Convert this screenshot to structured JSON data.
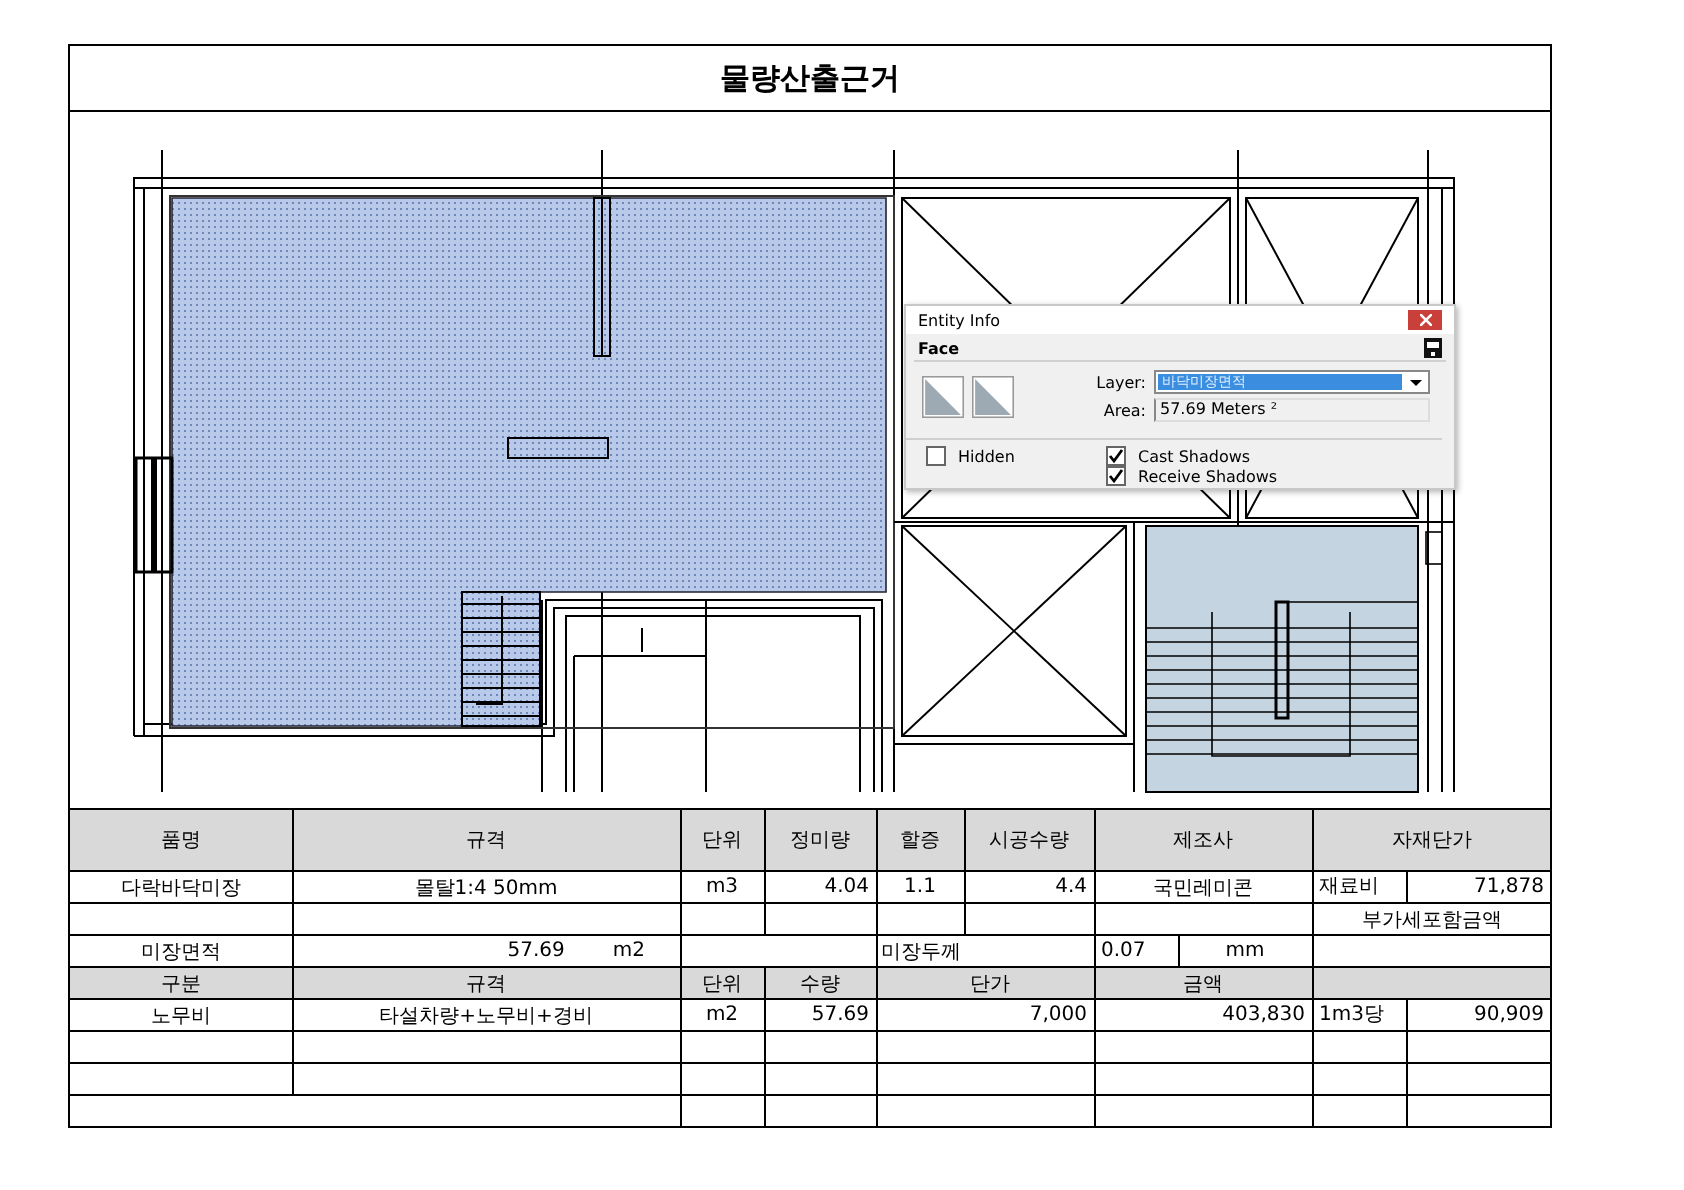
{
  "title": "물량산출근거",
  "entity_info": {
    "title": "Entity Info",
    "section": "Face",
    "layer_label": "Layer:",
    "layer_value": "바닥미장면적",
    "area_label": "Area:",
    "area_value": "57.69 Meters ²",
    "checkboxes": [
      {
        "label": "Hidden",
        "checked": false
      },
      {
        "label": "Cast Shadows",
        "checked": true
      },
      {
        "label": "Receive Shadows",
        "checked": true
      }
    ]
  },
  "table": {
    "rows": [
      {
        "kind": "header",
        "cells": [
          {
            "kind": "header",
            "text": "품명"
          },
          {
            "kind": "header",
            "text": "규격"
          },
          {
            "kind": "header",
            "text": "단위"
          },
          {
            "kind": "header",
            "text": "정미량"
          },
          {
            "kind": "header",
            "text": "할증"
          },
          {
            "kind": "header",
            "text": "시공수량"
          },
          {
            "kind": "header",
            "text": "제조사"
          },
          {
            "kind": "header",
            "text": "자재단가"
          }
        ]
      },
      {
        "kind": "data",
        "cells": [
          {
            "kind": "text",
            "text": "다락바닥미장"
          },
          {
            "kind": "text",
            "text": "몰탈1:4 50mm"
          },
          {
            "kind": "text",
            "text": "m3"
          },
          {
            "kind": "number",
            "text": "4.04"
          },
          {
            "kind": "text",
            "text": "1.1"
          },
          {
            "kind": "number",
            "text": "4.4"
          },
          {
            "kind": "text",
            "text": "국민레미콘"
          },
          {
            "kind": "split",
            "label": "재료비",
            "text": "71,878"
          }
        ]
      },
      {
        "kind": "data",
        "cells": [
          {
            "kind": "empty"
          },
          {
            "kind": "empty"
          },
          {
            "kind": "empty"
          },
          {
            "kind": "empty"
          },
          {
            "kind": "empty"
          },
          {
            "kind": "empty"
          },
          {
            "kind": "empty"
          },
          {
            "kind": "text",
            "text": "부가세포함금액"
          }
        ]
      },
      {
        "kind": "data",
        "cells": [
          {
            "kind": "text",
            "text": "미장면적"
          },
          {
            "kind": "measure",
            "text": "57.69",
            "unit": "m2"
          },
          {
            "kind": "empty"
          },
          {
            "kind": "open_left"
          },
          {
            "kind": "label",
            "text": "미장두께"
          },
          {
            "kind": "open_left"
          },
          {
            "kind": "split",
            "label": "0.07",
            "unit": "mm"
          },
          {
            "kind": "empty"
          }
        ]
      },
      {
        "kind": "subheader",
        "cells": [
          {
            "kind": "header",
            "text": "구분"
          },
          {
            "kind": "header",
            "text": "규격"
          },
          {
            "kind": "header",
            "text": "단위"
          },
          {
            "kind": "header",
            "text": "수량"
          },
          {
            "kind": "open_right"
          },
          {
            "kind": "header",
            "text": "단가"
          },
          {
            "kind": "header",
            "text": "금액"
          },
          {
            "kind": "header"
          }
        ]
      },
      {
        "kind": "data",
        "cells": [
          {
            "kind": "text",
            "text": "노무비"
          },
          {
            "kind": "text",
            "text": "타설차량+노무비+경비"
          },
          {
            "kind": "text",
            "text": "m2"
          },
          {
            "kind": "number",
            "text": "57.69"
          },
          {
            "kind": "open_right"
          },
          {
            "kind": "number",
            "text": "7,000"
          },
          {
            "kind": "number",
            "text": "403,830"
          },
          {
            "kind": "split",
            "label": "1m3당",
            "text": "90,909"
          }
        ]
      },
      {
        "kind": "data",
        "cells": [
          {
            "kind": "empty"
          },
          {
            "kind": "empty"
          },
          {
            "kind": "empty"
          },
          {
            "kind": "empty"
          },
          {
            "kind": "open_right"
          },
          {
            "kind": "empty"
          },
          {
            "kind": "empty"
          },
          {
            "kind": "split"
          }
        ]
      },
      {
        "kind": "data",
        "cells": [
          {
            "kind": "empty"
          },
          {
            "kind": "empty"
          },
          {
            "kind": "empty"
          },
          {
            "kind": "empty"
          },
          {
            "kind": "open_right"
          },
          {
            "kind": "empty"
          },
          {
            "kind": "empty"
          },
          {
            "kind": "split"
          }
        ]
      },
      {
        "kind": "data",
        "cells": [
          {
            "kind": "empty"
          },
          {
            "kind": "open_left"
          },
          {
            "kind": "empty"
          },
          {
            "kind": "empty"
          },
          {
            "kind": "open_right"
          },
          {
            "kind": "empty"
          },
          {
            "kind": "empty"
          },
          {
            "kind": "split"
          }
        ]
      }
    ]
  }
}
